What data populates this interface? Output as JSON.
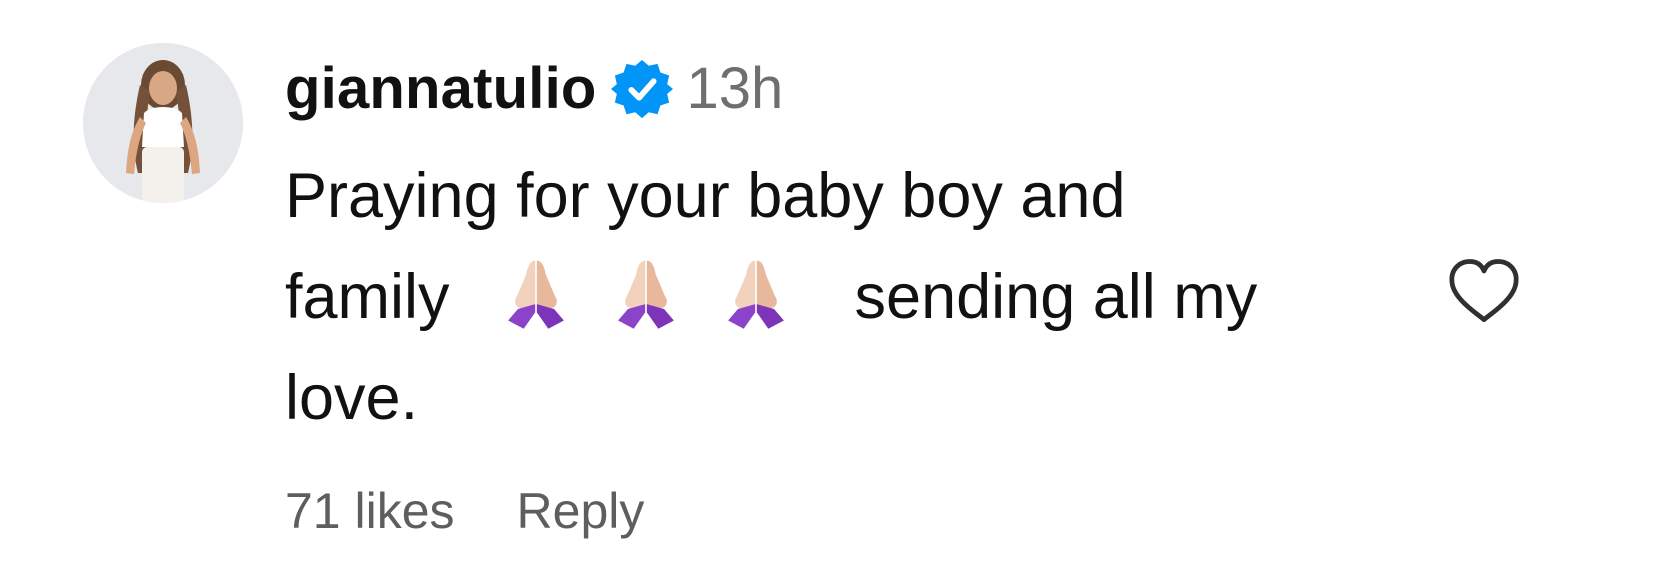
{
  "comment": {
    "username": "giannatulio",
    "verified_icon": "verified-badge-icon",
    "timestamp": "13h",
    "text_line1": "Praying for your baby boy and",
    "text_line2_start": "family",
    "emoji_name": "folded-hands-emoji",
    "emoji_count": 3,
    "text_line2_end": "sending all my",
    "text_line3": "love.",
    "likes_label": "71 likes",
    "reply_label": "Reply",
    "like_icon": "heart-outline-icon"
  },
  "colors": {
    "username": "#111111",
    "timestamp": "#6f6f6f",
    "meta": "#5e5e5e",
    "verified_badge": "#0095f6",
    "emoji_sleeve": "#8b43c9"
  }
}
